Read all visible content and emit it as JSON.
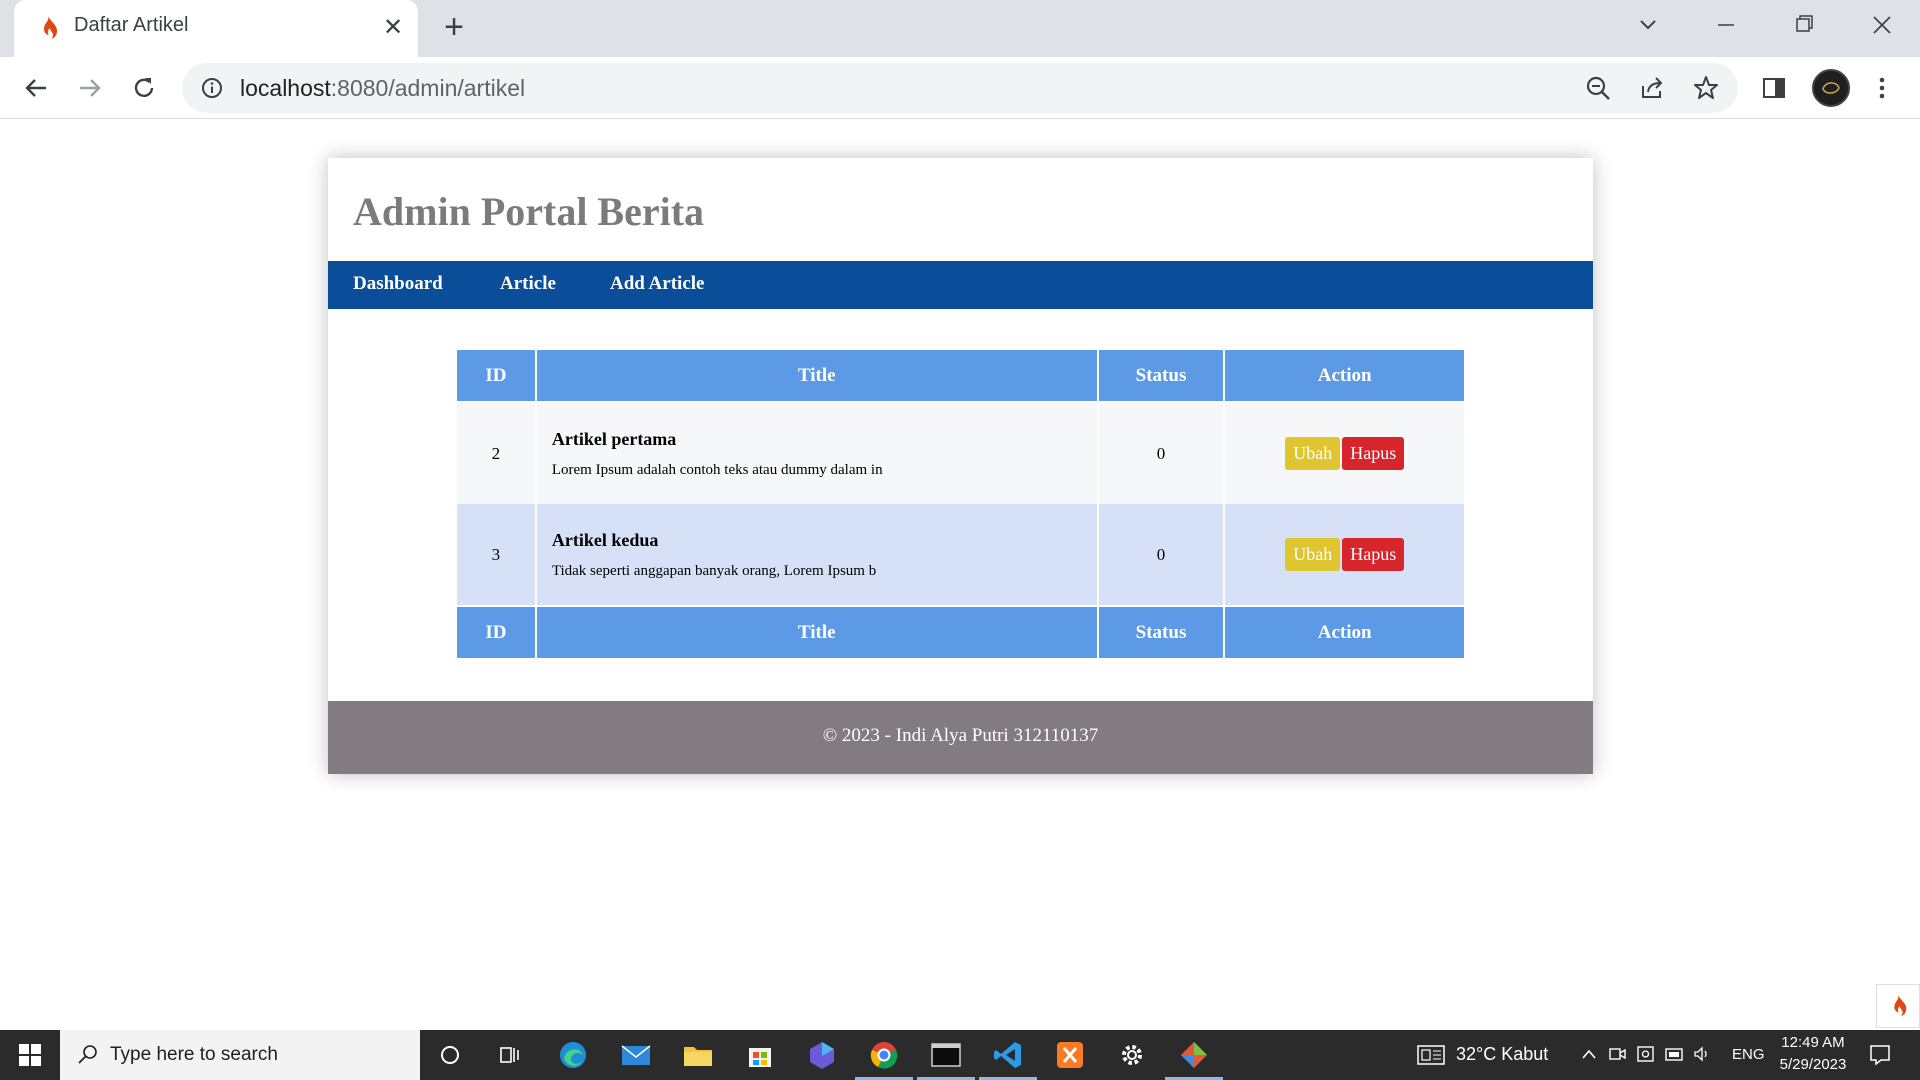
{
  "browser": {
    "tab_title": "Daftar Artikel",
    "tab_close": "✕",
    "new_tab": "+",
    "url_host": "localhost",
    "url_path": ":8080/admin/artikel"
  },
  "site": {
    "title": "Admin Portal Berita",
    "nav": [
      "Dashboard",
      "Article",
      "Add Article"
    ]
  },
  "table": {
    "headers": [
      "ID",
      "Title",
      "Status",
      "Action"
    ],
    "rows": [
      {
        "id": "2",
        "title": "Artikel pertama",
        "excerpt": "Lorem Ipsum adalah contoh teks atau dummy dalam in",
        "status": "0",
        "edit": "Ubah",
        "delete": "Hapus"
      },
      {
        "id": "3",
        "title": "Artikel kedua",
        "excerpt": "Tidak seperti anggapan banyak orang, Lorem Ipsum b",
        "status": "0",
        "edit": "Ubah",
        "delete": "Hapus"
      }
    ]
  },
  "footer": {
    "text": "© 2023 - Indi Alya Putri 312110137"
  },
  "taskbar": {
    "search_placeholder": "Type here to search",
    "weather": "32°C  Kabut",
    "lang": "ENG",
    "time": "12:49 AM",
    "date": "5/29/2023"
  },
  "colors": {
    "nav_bg": "#0a4d98",
    "table_header": "#5c9ae6",
    "row_alt": "#d6e0f7",
    "btn_edit": "#dfc631",
    "btn_delete": "#d6262c",
    "footer_bg": "#827c82"
  }
}
